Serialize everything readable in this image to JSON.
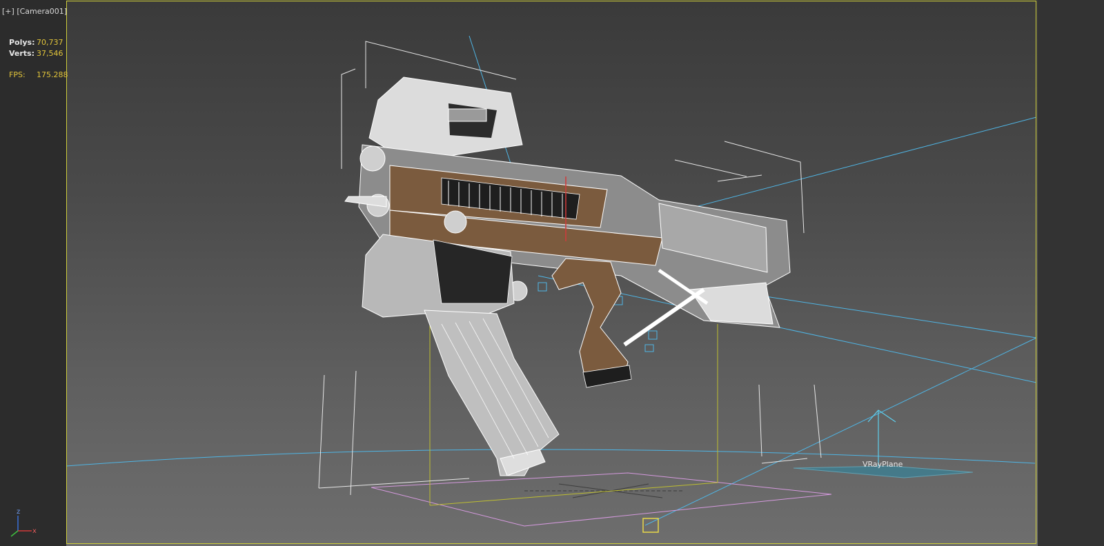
{
  "viewport": {
    "plus_label": "[+]",
    "camera_label": "[Camera001]"
  },
  "stats": {
    "polys_label": "Polys:",
    "polys_value": "70,737",
    "verts_label": "Verts:",
    "verts_value": "37,546",
    "fps_label": "FPS:",
    "fps_value": "175.288"
  },
  "scene": {
    "vray_plane_label": "VRayPlane"
  },
  "axis_tripod": {
    "z_label": "z",
    "x_label": "x"
  },
  "colors": {
    "safe_frame": "#cfcf3a",
    "wire": "#ffffff",
    "light_blue": "#4fb6e6",
    "pink": "#d69adf",
    "brown": "#7b5b3e"
  }
}
